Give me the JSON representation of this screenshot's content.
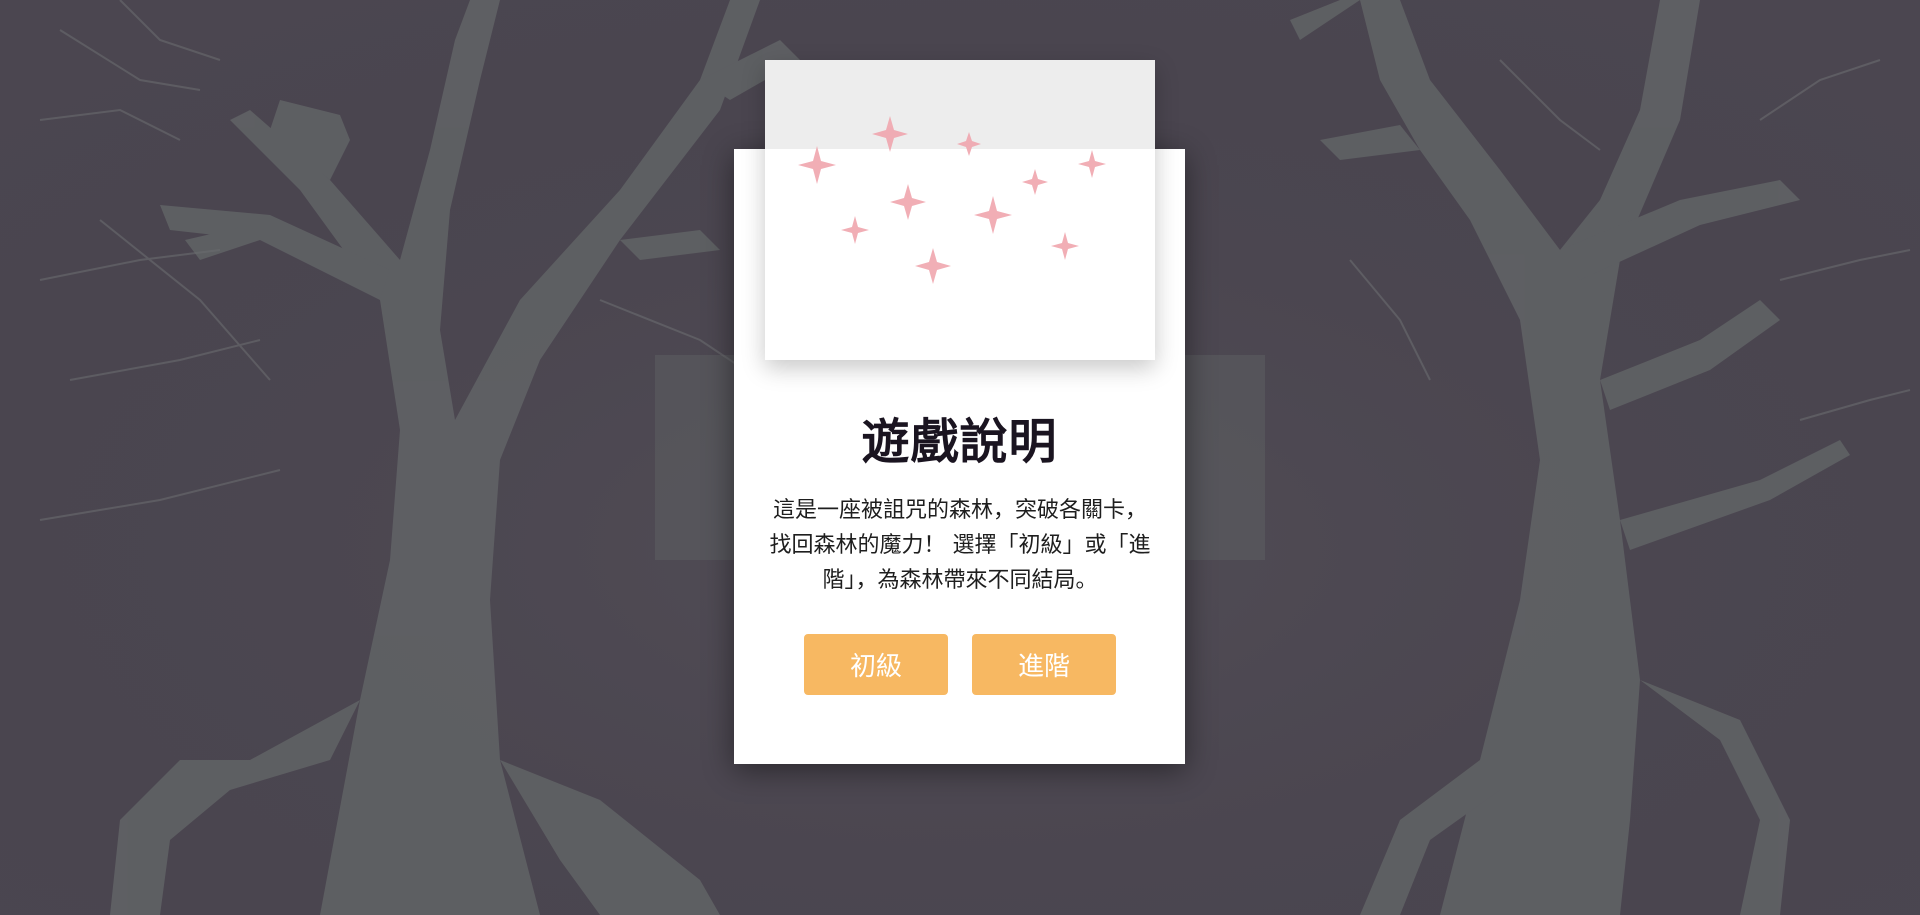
{
  "game": {
    "modal": {
      "title": "遊戲說明",
      "description": " 這是一座被詛咒的森林，突破各關卡，找回森林的魔力！ 選擇「初級」或「進階」，為森林帶來不同結局。",
      "buttons": {
        "beginner": "初級",
        "advanced": "進階"
      },
      "image_icon": "pink-sparkles-icon"
    },
    "background_icon": "cursed-forest-trees",
    "colors": {
      "background": "#4b4650",
      "tree": "#5f6164",
      "button": "#f7b862",
      "sparkle": "#f0a6ae"
    }
  }
}
